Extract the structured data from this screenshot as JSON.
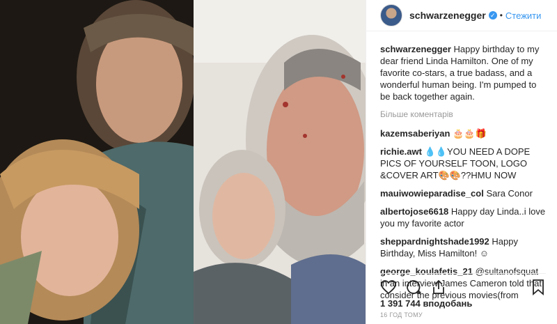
{
  "post": {
    "username": "schwarzenegger",
    "follow_label": "Стежити",
    "separator": "•",
    "caption": {
      "username": "schwarzenegger",
      "text": "Happy birthday to my dear friend Linda Hamilton. One of my favorite co-stars, a true badass, and a wonderful human being. I'm pumped to be back together again."
    },
    "more_comments": "Більше коментарів",
    "comments": [
      {
        "user": "kazemsaberiyan",
        "text": "🎂🎂🎁"
      },
      {
        "user": "richie.awt",
        "text": "💧💧YOU NEED A DOPE PICS OF YOURSELF TOON, LOGO &COVER ART🎨🎨??HMU NOW"
      },
      {
        "user": "mauiwowieparadise_col",
        "text": "Sara Conor"
      },
      {
        "user": "albertojose6618",
        "text": "Happy day Linda..i love you my favorite actor"
      },
      {
        "user": "sheppardnightshade1992",
        "text": "Happy Birthday, Miss Hamilton! ☺"
      },
      {
        "user": "george_koulafetis_21",
        "text": "@sultanofsquat in an interview James Cameron told that consider the previous movies(from"
      }
    ],
    "likes": "1 391 744 вподобань",
    "timestamp": "16 ГОД ТОМУ",
    "icons": {
      "like": "heart-icon",
      "comment": "comment-icon",
      "share": "share-icon",
      "save": "bookmark-icon",
      "verified": "verified-badge-icon"
    },
    "colors": {
      "accent": "#3897f0",
      "muted": "#999999",
      "text": "#262626"
    }
  }
}
